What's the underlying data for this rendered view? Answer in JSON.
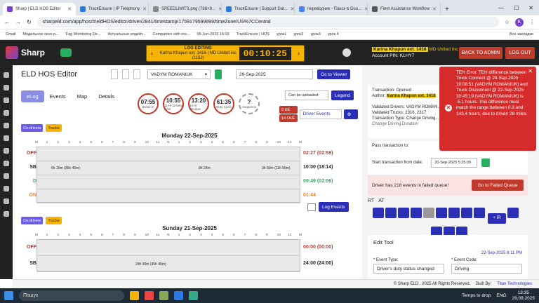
{
  "browser": {
    "tabs": [
      "Sharp | ELD HOS Editor",
      "TrackEnsure | IP Telephony",
      "SPEEDLIMITS.png (788×9...",
      "TrackEnsure | Support Dat...",
      "переводчик - Поиск в Goo...",
      "Fleet Assistance Workflow"
    ],
    "url": "sharpeld.com/app/hos/#/eldHOS/editor/driver/2841/timestamp/1759179599999/timeZone/US%7CCentral",
    "bookmarks": [
      "Gmail",
      "Модальное окно р...",
      "Fag Monitoring De...",
      "Актуальные апдейт...",
      "Companies with res...",
      "05-Jun-2023 16:03",
      "TrackEnsure | HOS",
      "урок1",
      "урок2",
      "урок3",
      "урок 4",
      "Все закладки"
    ]
  },
  "header": {
    "brand": "Sharp",
    "log_editing_title": "LOG EDITING",
    "log_editing_sub": "Karina Khapun ext. 1416 | MD United Inc (1152)",
    "timer": "00:10:25",
    "account_user": "Karina Khapun ext. 1416",
    "account_company": "MD United Inc",
    "account_pin": "Account PIN: KLHY7",
    "back_admin": "BACK TO ADMIN",
    "log_out": "LOG OUT"
  },
  "editor": {
    "title": "ELD HOS Editor",
    "driver": "VADYM ROMANIUK",
    "date": "29-Sep-2025",
    "go_viewer": "Go to Viewer",
    "tabs": [
      "eLog",
      "Events",
      "Map",
      "Details"
    ],
    "circles": [
      {
        "v": "07:55",
        "l": "Break In"
      },
      {
        "v": "10:55",
        "l": "11 Hr Driving Limit"
      },
      {
        "v": "13:20",
        "l": "14 Hr Window"
      },
      {
        "v": "61:35",
        "l": "Duty Cycle"
      },
      {
        "v": "?",
        "l": "Sequence"
      }
    ],
    "upload_label": "Can be uploaded:",
    "legend": "Legend",
    "driver_events": "Driver Events",
    "badges": [
      "0 UE",
      "14 OUE"
    ],
    "codrivers": "Co-drivers",
    "trucks": "Trucks",
    "log_events": "Log Events"
  },
  "day1": {
    "title": "Monday 22-Sep-2025",
    "rows": [
      {
        "k": "OFF",
        "t": "02:27 (02:59)",
        "c": "#c0392b"
      },
      {
        "k": "SB",
        "t": "10:00 (18:14)",
        "c": "#222"
      },
      {
        "k": "D",
        "t": "09:49 (02:06)",
        "c": "#27ae60"
      },
      {
        "k": "ON",
        "t": "01:44",
        "c": "#e67e22"
      }
    ],
    "notes": [
      "6h 10m (35h 46m)",
      "8h 24m",
      "3h 50m (11h 50m)"
    ]
  },
  "day2": {
    "title": "Sunday 21-Sep-2025",
    "rows": [
      {
        "k": "OFF",
        "t": "00:00 (00:00)",
        "c": "#c0392b"
      },
      {
        "k": "SB",
        "t": "24:00 (24:00)",
        "c": "#222"
      }
    ],
    "notes": [
      "24h 00m (35h 46m)"
    ]
  },
  "ticks": [
    "M",
    "1",
    "2",
    "3",
    "4",
    "5",
    "6",
    "7",
    "8",
    "9",
    "10",
    "11",
    "N",
    "1",
    "2",
    "3",
    "4",
    "5",
    "6",
    "7",
    "8",
    "9",
    "10",
    "11",
    "M"
  ],
  "panel": {
    "transaction": "Transaction: Opened",
    "author_label": "Author:",
    "author": "Karina Khapun ext. 1416",
    "validated_drivers": "Validated Drivers: VADYM ROMAN...",
    "validated_trucks": "Validated Trucks: 2316, 2317",
    "transaction_type": "Transaction Type: Change Driving...",
    "change_duration": "Change Driving Duration",
    "pass_to": "Pass transaction to:",
    "start_from": "Start transaction from date:",
    "start_date": "20-Sep-2025 5:25:09",
    "failed_msg": "Driver has 218 events in failed queue!",
    "failed_count": "218",
    "go_failed": "Go to Failed Queue",
    "rt": "RT",
    "at": "AT",
    "ir_btn": "+ IR",
    "edit_tool": "Edit Tool",
    "edit_time": "22-Sep-2025 8:11 PM",
    "event_type_label": "* Event Type:",
    "event_type": "Driver's duty status changed",
    "event_code_label": "* Event Code:",
    "event_code": "Driving"
  },
  "error": {
    "text": "TEH Error. TEH difference between Truck Connect @ 28-Sep-2025 10:08:51 (VADYM ROMANIUK) and Truck Disconnect @ 22-Sep-2025 10:45:19 (VADYM ROMANIUK) is -5.1 hours. This difference must match the range between 0.3 and 143.4 hours, due to driven 28 miles."
  },
  "footer": {
    "copy": "© Sharp ELD . 2025 All Rights Reserved.",
    "built": "Built By:",
    "vendor": "Titan Technologies"
  },
  "taskbar": {
    "search": "Пошук",
    "weather": "Temps to drop",
    "lang": "ENG",
    "time": "13:35",
    "date": "29.09.2025"
  }
}
